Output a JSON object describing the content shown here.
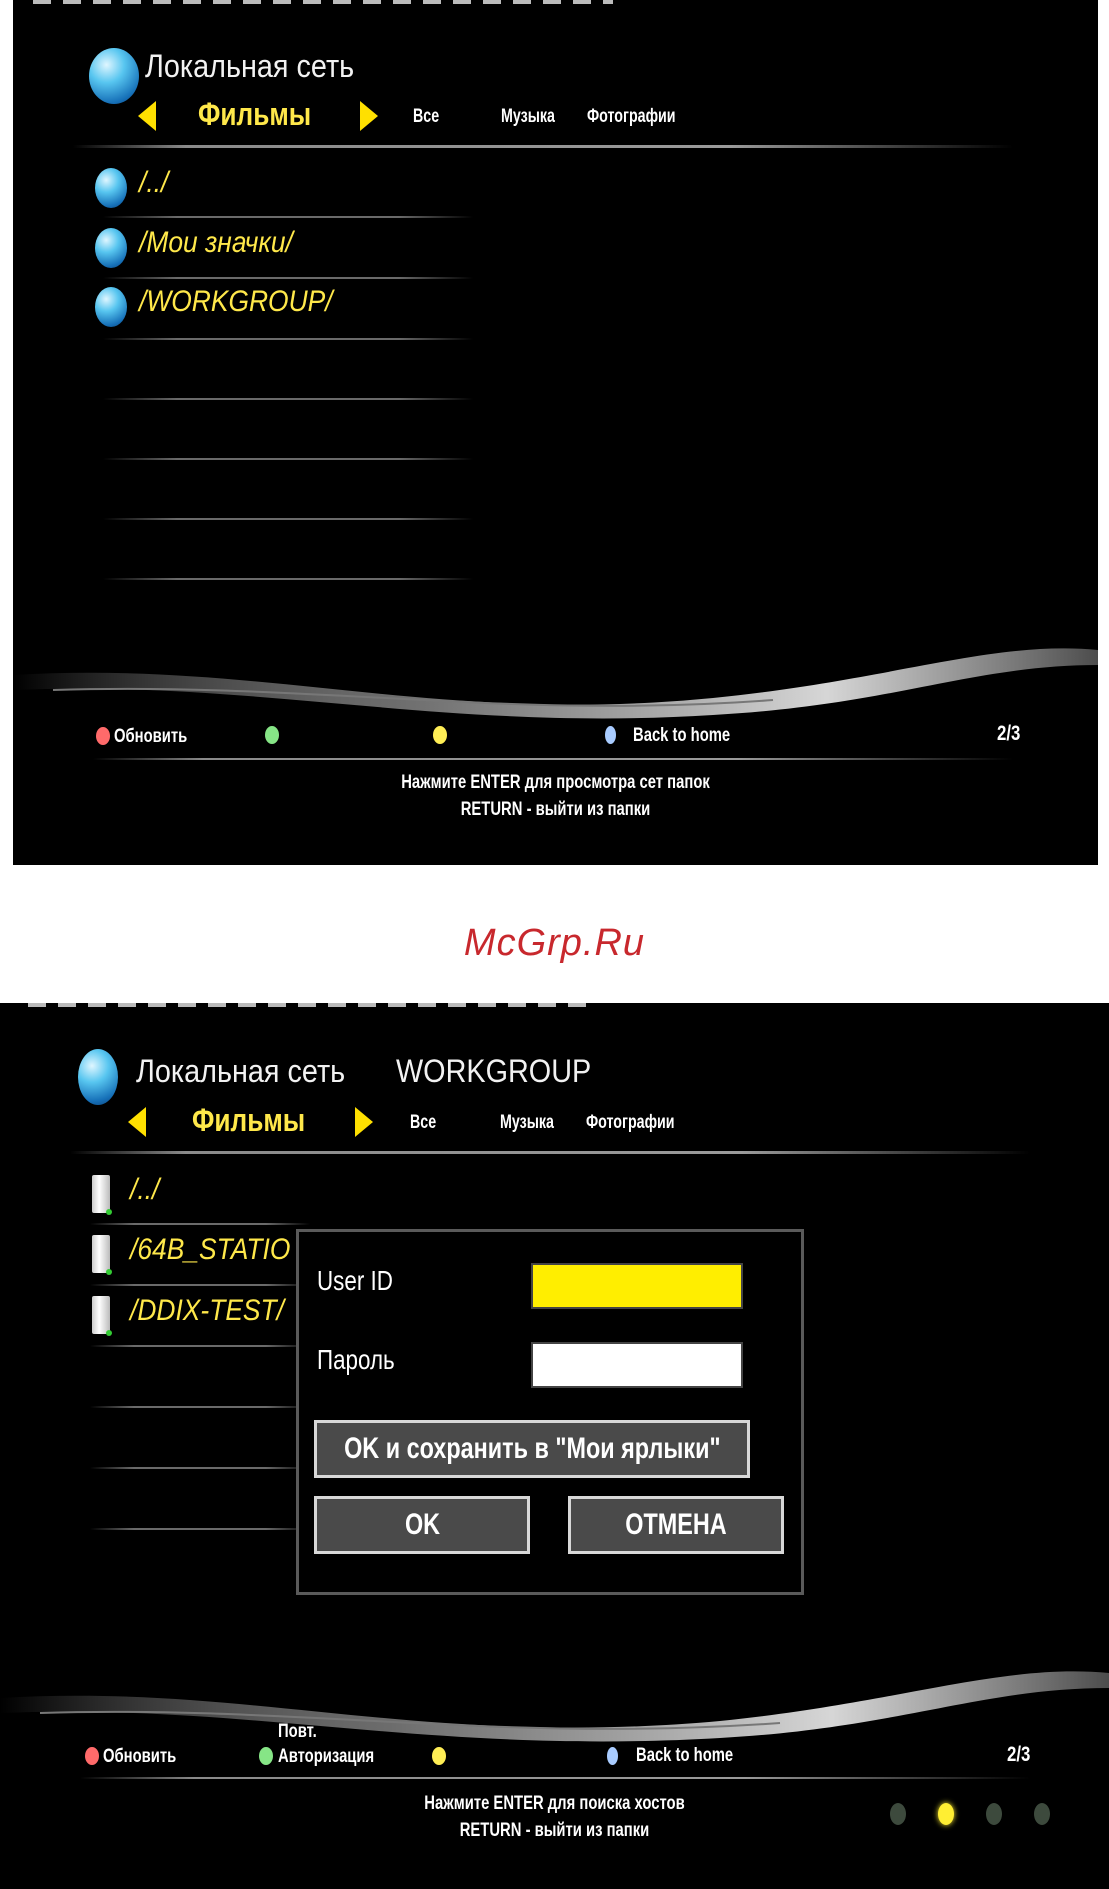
{
  "screen1": {
    "title": "Локальная сеть",
    "category_active": "Фильмы",
    "categories": [
      "Все",
      "Музыка",
      "Фотографии"
    ],
    "items": [
      "/../",
      "/Мои значки/",
      "/WORKGROUP/"
    ],
    "footer": {
      "red_label": "Обновить",
      "blue_label": "Back to home",
      "page": "2/3"
    },
    "message_line1": "Нажмите ENTER для просмотра сет папок",
    "message_line2": "RETURN - выйти из папки"
  },
  "watermark": "McGrp.Ru",
  "screen2": {
    "title": "Локальная сеть",
    "subtitle": "WORKGROUP",
    "category_active": "Фильмы",
    "categories": [
      "Все",
      "Музыка",
      "Фотографии"
    ],
    "items": [
      "/../",
      "/64B_STATIO",
      "/DDIX-TEST/"
    ],
    "dialog": {
      "user_id_label": "User ID",
      "password_label": "Пароль",
      "save_button": "OK и сохранить в   \"Мои ярлыки\"",
      "ok_button": "OK",
      "cancel_button": "ОТМЕНА"
    },
    "footer": {
      "red_label": "Обновить",
      "green_label_line1": "Повт.",
      "green_label_line2": "Авторизация",
      "blue_label": "Back to home",
      "page": "2/3"
    },
    "message_line1": "Нажмите ENTER для поиска хостов",
    "message_line2": "RETURN - выйти из папки"
  },
  "colors": {
    "accent_yellow": "#ffe84a",
    "red_button": "#ff5a5a",
    "green_button": "#7de07d",
    "yellow_button": "#ffee33",
    "blue_button": "#9fc8ff",
    "watermark": "#c8282d"
  }
}
